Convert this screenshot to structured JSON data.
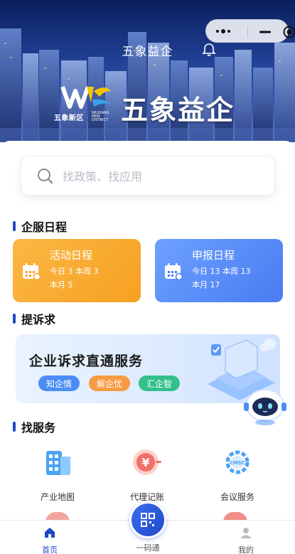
{
  "header": {
    "title": "五象益企",
    "brand_text": "五象益企",
    "logo_district": "五象新区",
    "logo_en": "WUXIANG NEW DISTRICT"
  },
  "search": {
    "placeholder": "找政策、找应用"
  },
  "schedule": {
    "section_title": "企服日程",
    "cards": [
      {
        "title": "活动日程",
        "line1": "今日 3  本周 3",
        "line2": "本月 5",
        "color": "#f6a022"
      },
      {
        "title": "申报日程",
        "line1": "今日 13  本周 13",
        "line2": "本月 17",
        "color": "#4a7bf2"
      }
    ]
  },
  "appeal": {
    "section_title": "提诉求",
    "banner_title": "企业诉求直通服务",
    "tags": [
      "知企情",
      "解企忧",
      "汇企智"
    ]
  },
  "services": {
    "section_title": "找服务",
    "items": [
      {
        "label": "产业地图",
        "icon": "building-map-icon"
      },
      {
        "label": "代理记账",
        "icon": "yen-coin-icon"
      },
      {
        "label": "会议服务",
        "icon": "cmsc-gear-icon"
      }
    ]
  },
  "tabbar": {
    "items": [
      {
        "label": "首页",
        "icon": "home-icon",
        "active": true
      },
      {
        "label": "一码通",
        "icon": "qr-code-icon",
        "active": false
      },
      {
        "label": "我的",
        "icon": "user-icon",
        "active": false
      }
    ]
  },
  "colors": {
    "accent": "#1f48c6",
    "orange": "#f6a022",
    "blue": "#4a7bf2"
  }
}
